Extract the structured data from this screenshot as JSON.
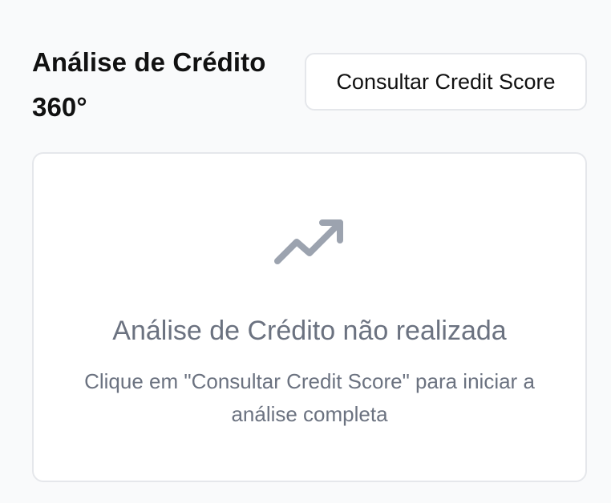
{
  "header": {
    "title": "Análise de Crédito 360°",
    "consult_button_label": "Consultar Credit Score"
  },
  "empty_state": {
    "icon": "trending-up-icon",
    "title": "Análise de Crédito não realizada",
    "description": "Clique em \"Consultar Credit Score\" para iniciar a análise completa"
  },
  "colors": {
    "background": "#f9fafb",
    "card_background": "#ffffff",
    "border": "#e5e7eb",
    "muted_text": "#6b7280",
    "icon": "#9ca3af",
    "title_text": "#111111"
  }
}
